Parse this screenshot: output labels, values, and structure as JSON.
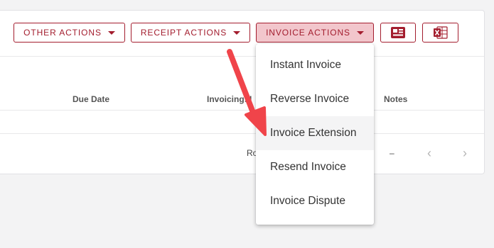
{
  "toolbar": {
    "other_actions": "OTHER ACTIONS",
    "receipt_actions": "RECEIPT ACTIONS",
    "invoice_actions": "INVOICE ACTIONS",
    "icon_view": "card-view-icon",
    "icon_export": "excel-export-icon"
  },
  "table": {
    "headers": {
      "due_date": "Due Date",
      "invoicing": "Invoicing: I",
      "notes": "Notes"
    },
    "row": {
      "cell_partial": "Ro",
      "notes": "–"
    }
  },
  "pagination": {
    "prev": "‹",
    "next": "›"
  },
  "invoice_menu": {
    "items": [
      "Instant Invoice",
      "Reverse Invoice",
      "Invoice Extension",
      "Resend Invoice",
      "Invoice Dispute"
    ],
    "highlighted_index": 2
  },
  "colors": {
    "accent": "#a31d2e",
    "active_button_bg": "#f2c6cc",
    "annotation_arrow": "#f0444a"
  }
}
